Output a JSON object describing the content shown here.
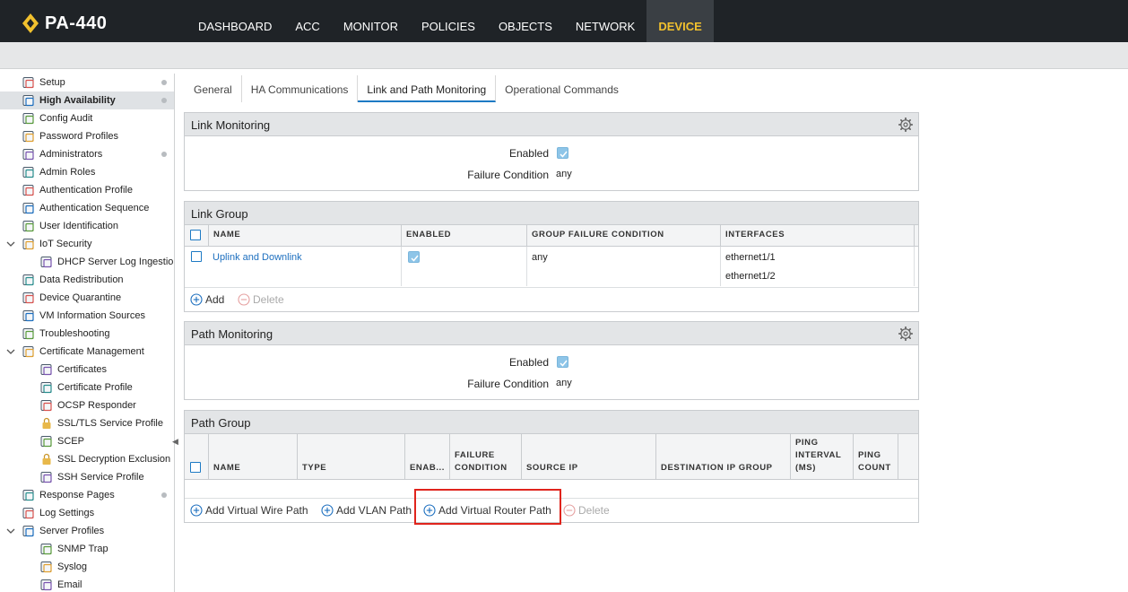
{
  "app": {
    "title": "PA-440",
    "nav": [
      "DASHBOARD",
      "ACC",
      "MONITOR",
      "POLICIES",
      "OBJECTS",
      "NETWORK",
      "DEVICE"
    ]
  },
  "sidebar": {
    "items": [
      {
        "label": "Setup",
        "icon": "setup-icon"
      },
      {
        "label": "High Availability",
        "icon": "high-availability-icon"
      },
      {
        "label": "Config Audit",
        "icon": "config-audit-icon"
      },
      {
        "label": "Password Profiles",
        "icon": "password-profiles-icon"
      },
      {
        "label": "Administrators",
        "icon": "administrators-icon"
      },
      {
        "label": "Admin Roles",
        "icon": "admin-roles-icon"
      },
      {
        "label": "Authentication Profile",
        "icon": "authentication-profile-icon"
      },
      {
        "label": "Authentication Sequence",
        "icon": "authentication-sequence-icon"
      },
      {
        "label": "User Identification",
        "icon": "user-identification-icon"
      },
      {
        "label": "IoT Security",
        "icon": "iot-security-icon"
      },
      {
        "label": "DHCP Server Log Ingestion",
        "icon": "dhcp-icon"
      },
      {
        "label": "Data Redistribution",
        "icon": "data-redistribution-icon"
      },
      {
        "label": "Device Quarantine",
        "icon": "device-quarantine-icon"
      },
      {
        "label": "VM Information Sources",
        "icon": "vm-info-icon"
      },
      {
        "label": "Troubleshooting",
        "icon": "troubleshooting-icon"
      },
      {
        "label": "Certificate Management",
        "icon": "certificate-management-icon"
      },
      {
        "label": "Certificates",
        "icon": "certificates-icon"
      },
      {
        "label": "Certificate Profile",
        "icon": "certificate-profile-icon"
      },
      {
        "label": "OCSP Responder",
        "icon": "ocsp-icon"
      },
      {
        "label": "SSL/TLS Service Profile",
        "icon": "lock-icon"
      },
      {
        "label": "SCEP",
        "icon": "scep-icon"
      },
      {
        "label": "SSL Decryption Exclusion",
        "icon": "lock-icon"
      },
      {
        "label": "SSH Service Profile",
        "icon": "ssh-icon"
      },
      {
        "label": "Response Pages",
        "icon": "response-pages-icon"
      },
      {
        "label": "Log Settings",
        "icon": "log-settings-icon"
      },
      {
        "label": "Server Profiles",
        "icon": "server-profiles-icon"
      },
      {
        "label": "SNMP Trap",
        "icon": "snmp-icon"
      },
      {
        "label": "Syslog",
        "icon": "syslog-icon"
      },
      {
        "label": "Email",
        "icon": "email-icon"
      }
    ]
  },
  "tabs": [
    "General",
    "HA Communications",
    "Link and Path Monitoring",
    "Operational Commands"
  ],
  "link_monitoring": {
    "title": "Link Monitoring",
    "enabled_label": "Enabled",
    "failure_label": "Failure Condition",
    "failure_value": "any"
  },
  "link_group": {
    "title": "Link Group",
    "columns": [
      "NAME",
      "ENABLED",
      "GROUP FAILURE CONDITION",
      "INTERFACES"
    ],
    "rows": [
      {
        "name": "Uplink and Downlink",
        "condition": "any",
        "interfaces": [
          "ethernet1/1",
          "ethernet1/2"
        ]
      }
    ],
    "add_label": "Add",
    "delete_label": "Delete"
  },
  "path_monitoring": {
    "title": "Path Monitoring",
    "enabled_label": "Enabled",
    "failure_label": "Failure Condition",
    "failure_value": "any"
  },
  "path_group": {
    "title": "Path Group",
    "columns": [
      "NAME",
      "TYPE",
      "ENAB...",
      "FAILURE CONDITION",
      "SOURCE IP",
      "DESTINATION IP GROUP",
      "PING INTERVAL (MS)",
      "PING COUNT"
    ],
    "add_wire_label": "Add Virtual Wire Path",
    "add_vlan_label": "Add VLAN Path",
    "add_router_label": "Add Virtual Router Path",
    "delete_label": "Delete"
  },
  "colors": {
    "accent": "#f2c12e",
    "link": "#1d6fbf",
    "highlight": "#e0241c"
  }
}
